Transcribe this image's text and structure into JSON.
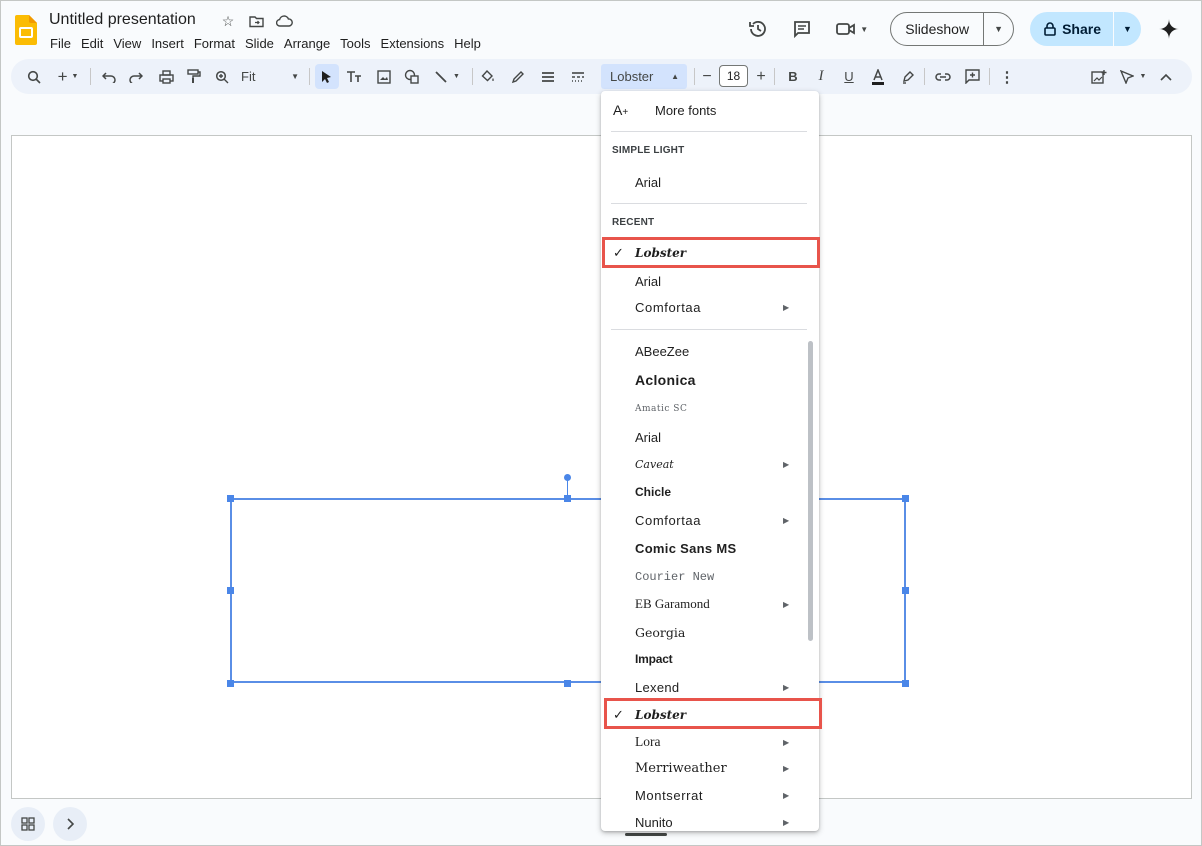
{
  "header": {
    "doc_title": "Untitled presentation",
    "menu": [
      "File",
      "Edit",
      "View",
      "Insert",
      "Format",
      "Slide",
      "Arrange",
      "Tools",
      "Extensions",
      "Help"
    ],
    "slideshow_label": "Slideshow",
    "share_label": "Share"
  },
  "toolbar": {
    "zoom_label": "Fit",
    "font_name": "Lobster",
    "font_size": "18"
  },
  "font_menu": {
    "more_fonts": "More fonts",
    "theme_heading": "SIMPLE LIGHT",
    "theme_fonts": [
      "Arial"
    ],
    "recent_heading": "RECENT",
    "recent_fonts": [
      "Lobster",
      "Arial",
      "Comfortaa"
    ],
    "all_fonts": [
      "ABeeZee",
      "Aclonica",
      "Amatic SC",
      "Arial",
      "Caveat",
      "Chicle",
      "Comfortaa",
      "Comic Sans MS",
      "Courier New",
      "EB Garamond",
      "Georgia",
      "Impact",
      "Lexend",
      "Lobster",
      "Lora",
      "Merriweather",
      "Montserrat",
      "Nunito"
    ],
    "selected_font": "Lobster"
  },
  "colors": {
    "accent": "#1a73e8",
    "share_bg": "#c2e7ff",
    "highlight_box": "#e8544b",
    "selection_handles": "#4a86e8"
  }
}
